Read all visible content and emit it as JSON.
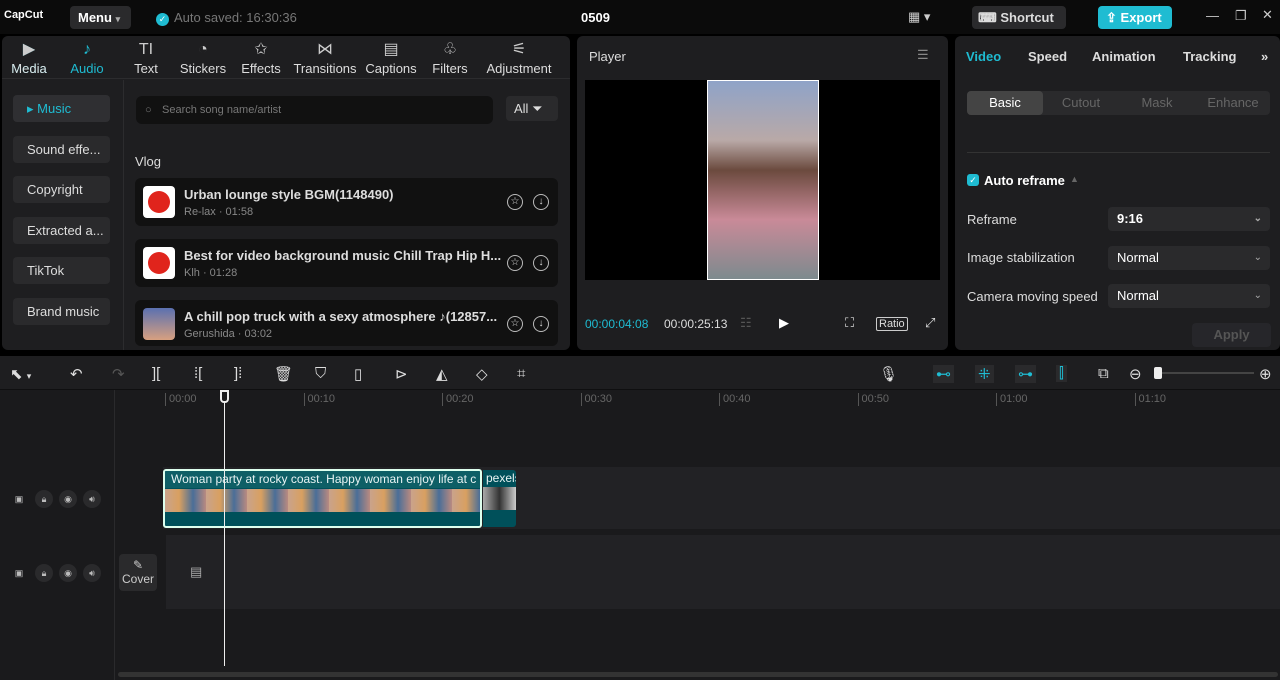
{
  "app": {
    "logo": "CapCut",
    "menu": "Menu",
    "autosave": "Auto saved: 16:30:36",
    "project_title": "0509",
    "shortcut": "Shortcut",
    "export": "Export",
    "accent": "#1fbcd2"
  },
  "toolbar_tabs": [
    {
      "label": "Media",
      "icon": "▶"
    },
    {
      "label": "Audio",
      "icon": "♪"
    },
    {
      "label": "Text",
      "icon": "TI"
    },
    {
      "label": "Stickers",
      "icon": "◔"
    },
    {
      "label": "Effects",
      "icon": "✩"
    },
    {
      "label": "Transitions",
      "icon": "⋈"
    },
    {
      "label": "Captions",
      "icon": "▤"
    },
    {
      "label": "Filters",
      "icon": "♧"
    },
    {
      "label": "Adjustment",
      "icon": "⚟"
    }
  ],
  "categories": [
    "Music",
    "Sound effe...",
    "Copyright",
    "Extracted a...",
    "TikTok",
    "Brand music"
  ],
  "search": {
    "placeholder": "Search song name/artist",
    "filter": "All"
  },
  "section": "Vlog",
  "songs": [
    {
      "title": "Urban lounge style BGM(1148490)",
      "sub": "Re-lax · 01:58"
    },
    {
      "title": "Best for video background music Chill Trap Hip H...",
      "sub": "Klh · 01:28"
    },
    {
      "title": "A chill pop truck with a sexy atmosphere ♪(12857...",
      "sub": "Gerushida · 03:02"
    }
  ],
  "player": {
    "title": "Player",
    "current": "00:00:04:08",
    "total": "00:00:25:13",
    "ratio": "Ratio"
  },
  "right": {
    "tabs": [
      "Video",
      "Speed",
      "Animation",
      "Tracking"
    ],
    "subtabs": [
      "Basic",
      "Cutout",
      "Mask",
      "Enhance"
    ],
    "auto_reframe": "Auto reframe",
    "rows": [
      {
        "label": "Reframe",
        "value": "9:16"
      },
      {
        "label": "Image stabilization",
        "value": "Normal"
      },
      {
        "label": "Camera moving speed",
        "value": "Normal"
      }
    ],
    "apply": "Apply"
  },
  "timeline": {
    "ticks": [
      "00:00",
      "00:10",
      "00:20",
      "00:30",
      "00:40",
      "00:50",
      "01:00",
      "01:10"
    ],
    "clip1": "Woman party at rocky coast. Happy woman enjoy life at c",
    "clip2": "pexels",
    "cover": "Cover"
  }
}
